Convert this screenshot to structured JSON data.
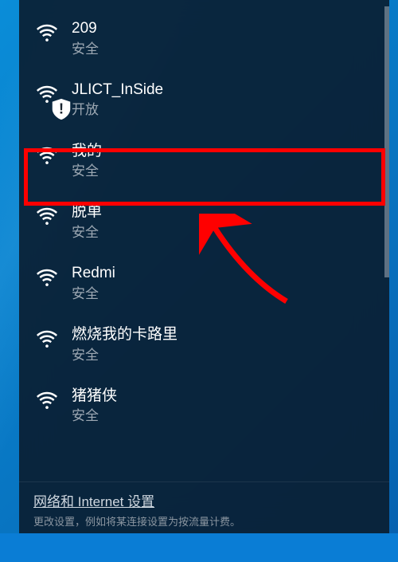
{
  "networks": [
    {
      "name": "209",
      "security": "安全",
      "open": false
    },
    {
      "name": "JLICT_InSide",
      "security": "开放",
      "open": true
    },
    {
      "name": "我的",
      "security": "安全",
      "open": false
    },
    {
      "name": "脱单",
      "security": "安全",
      "open": false
    },
    {
      "name": "Redmi",
      "security": "安全",
      "open": false
    },
    {
      "name": "燃烧我的卡路里",
      "security": "安全",
      "open": false
    },
    {
      "name": "猪猪侠",
      "security": "安全",
      "open": false
    }
  ],
  "footer": {
    "settings_link": "网络和 Internet 设置",
    "settings_sub": "更改设置，例如将某连接设置为按流量计费。"
  },
  "annotation": {
    "highlighted_index": 2
  }
}
